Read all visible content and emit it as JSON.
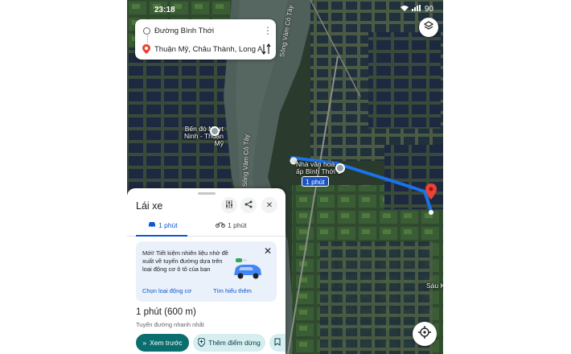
{
  "status_bar": {
    "time": "23:18",
    "battery": "90"
  },
  "search": {
    "origin": "Đường Bình Thới",
    "destination": "Thuận Mỹ, Châu Thành, Long An"
  },
  "map": {
    "labels": {
      "ferry": "Bến đò Nhựt Ninh - Thuận Mỹ",
      "culture_house": "Nhà văn hoá ấp Bình Thới 1",
      "river_top": "Sông Vàm Cỏ Tây",
      "river_bottom": "Sông Vàm Cỏ Tây",
      "sau_k": "Sáu K"
    },
    "duration_tag": "1 phút",
    "route_color": "#1a73e8",
    "pin_color": "#ea4335"
  },
  "sheet": {
    "title": "Lái xe",
    "tabs": [
      {
        "icon": "car-icon",
        "label": "1 phút"
      },
      {
        "icon": "motorbike-icon",
        "label": "1 phút"
      }
    ],
    "promo": {
      "text": "Mới! Tiết kiệm nhiên liệu nhờ đề xuất về tuyến đường dựa trên loại động cơ ô tô của bạn",
      "link_choose": "Chọn loại động cơ",
      "link_learn": "Tìm hiểu thêm"
    },
    "route_time": "1 phút (600 m)",
    "route_sub": "Tuyến đường nhanh nhất",
    "buttons": {
      "preview": "Xem trước",
      "add_stop": "Thêm điểm dừng"
    }
  },
  "colors": {
    "accent": "#0b57d0",
    "primary_button": "#0b6e6e",
    "secondary_button": "#d6eef0"
  }
}
